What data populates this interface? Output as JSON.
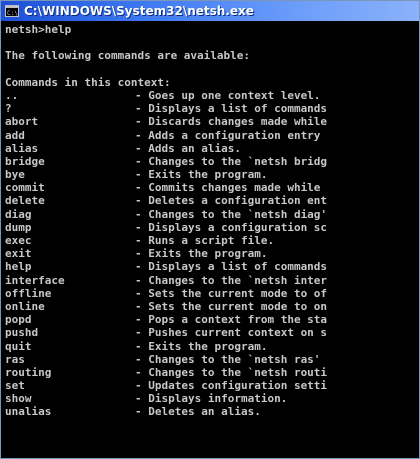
{
  "window": {
    "title": "C:\\WINDOWS\\System32\\netsh.exe",
    "icon": "console-icon"
  },
  "console": {
    "prompt_line": "netsh>help",
    "intro": "The following commands are available:",
    "context_header": "Commands in this context:",
    "commands": [
      {
        "name": "..",
        "desc": "- Goes up one context level."
      },
      {
        "name": "?",
        "desc": "- Displays a list of commands"
      },
      {
        "name": "abort",
        "desc": "- Discards changes made while"
      },
      {
        "name": "add",
        "desc": "- Adds a configuration entry"
      },
      {
        "name": "alias",
        "desc": "- Adds an alias."
      },
      {
        "name": "bridge",
        "desc": "- Changes to the `netsh bridg"
      },
      {
        "name": "bye",
        "desc": "- Exits the program."
      },
      {
        "name": "commit",
        "desc": "- Commits changes made while"
      },
      {
        "name": "delete",
        "desc": "- Deletes a configuration ent"
      },
      {
        "name": "diag",
        "desc": "- Changes to the `netsh diag'"
      },
      {
        "name": "dump",
        "desc": "- Displays a configuration sc"
      },
      {
        "name": "exec",
        "desc": "- Runs a script file."
      },
      {
        "name": "exit",
        "desc": "- Exits the program."
      },
      {
        "name": "help",
        "desc": "- Displays a list of commands"
      },
      {
        "name": "interface",
        "desc": "- Changes to the `netsh inter"
      },
      {
        "name": "offline",
        "desc": "- Sets the current mode to of"
      },
      {
        "name": "online",
        "desc": "- Sets the current mode to on"
      },
      {
        "name": "popd",
        "desc": "- Pops a context from the sta"
      },
      {
        "name": "pushd",
        "desc": "- Pushes current context on s"
      },
      {
        "name": "quit",
        "desc": "- Exits the program."
      },
      {
        "name": "ras",
        "desc": "- Changes to the `netsh ras'"
      },
      {
        "name": "routing",
        "desc": "- Changes to the `netsh routi"
      },
      {
        "name": "set",
        "desc": "- Updates configuration setti"
      },
      {
        "name": "show",
        "desc": "- Displays information."
      },
      {
        "name": "unalias",
        "desc": "- Deletes an alias."
      }
    ]
  },
  "colors": {
    "console_bg": "#000000",
    "console_text": "#c8c8c8",
    "titlebar": "#2a5fe0"
  }
}
